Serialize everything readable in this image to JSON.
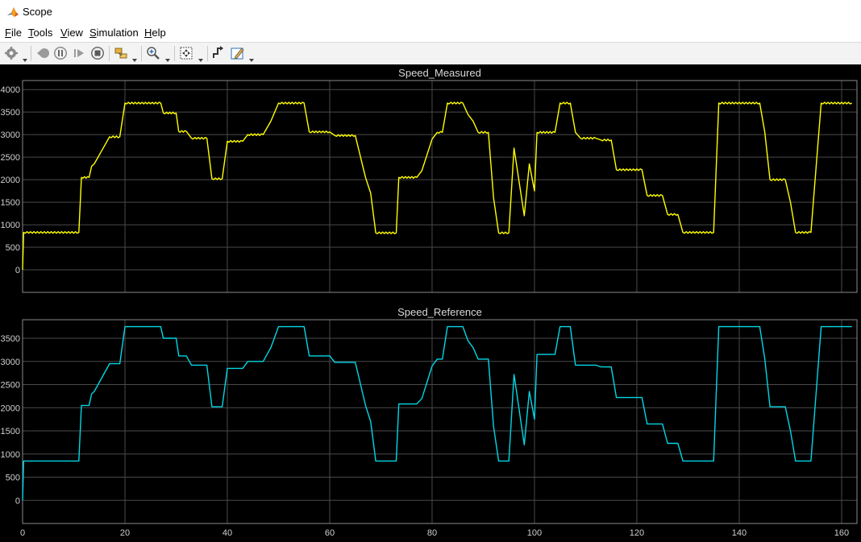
{
  "window": {
    "title": "Scope"
  },
  "menu": [
    {
      "label": "File",
      "key": "F",
      "rest": "ile"
    },
    {
      "label": "Tools",
      "key": "T",
      "rest": "ools"
    },
    {
      "label": "View",
      "key": "V",
      "rest": "iew"
    },
    {
      "label": "Simulation",
      "key": "S",
      "rest": "imulation"
    },
    {
      "label": "Help",
      "key": "H",
      "rest": "elp"
    }
  ],
  "toolbar": [
    "gear-icon",
    "step-back-icon",
    "pause-icon",
    "step-forward-icon",
    "stop-icon",
    "highlight-block-icon",
    "zoom-in-icon",
    "zoom-to-fit-icon",
    "trigger-icon",
    "write-data-icon"
  ],
  "colors": {
    "measured": "#ffff00",
    "reference": "#00d8e6",
    "background": "#000000",
    "grid": "#4a4a4a",
    "axes": "#8a8a8a"
  },
  "chart_data": [
    {
      "type": "line",
      "title": "Speed_Measured",
      "xlim": [
        0,
        163
      ],
      "ylim": [
        -500,
        4200
      ],
      "xticks": [
        0,
        20,
        40,
        60,
        80,
        100,
        120,
        140,
        160
      ],
      "yticks": [
        0,
        500,
        1000,
        1500,
        2000,
        2500,
        3000,
        3500,
        4000
      ],
      "grid": true,
      "series": [
        {
          "color": "#ffff00",
          "noise": true,
          "points": [
            [
              0,
              0
            ],
            [
              0.2,
              830
            ],
            [
              11,
              830
            ],
            [
              11.5,
              2050
            ],
            [
              13,
              2050
            ],
            [
              13.5,
              2300
            ],
            [
              14,
              2350
            ],
            [
              17,
              2950
            ],
            [
              19,
              2950
            ],
            [
              20,
              3700
            ],
            [
              27,
              3700
            ],
            [
              27.5,
              3480
            ],
            [
              30,
              3480
            ],
            [
              30.5,
              3070
            ],
            [
              32,
              3070
            ],
            [
              33,
              2920
            ],
            [
              36,
              2920
            ],
            [
              37,
              2020
            ],
            [
              39,
              2020
            ],
            [
              40,
              2850
            ],
            [
              43,
              2850
            ],
            [
              44,
              3000
            ],
            [
              47,
              3000
            ],
            [
              48,
              3200
            ],
            [
              48.5,
              3300
            ],
            [
              50,
              3700
            ],
            [
              55,
              3700
            ],
            [
              56,
              3060
            ],
            [
              60,
              3060
            ],
            [
              61,
              2980
            ],
            [
              65,
              2980
            ],
            [
              67,
              2050
            ],
            [
              68,
              1700
            ],
            [
              69,
              820
            ],
            [
              73,
              820
            ],
            [
              73.5,
              2050
            ],
            [
              77,
              2050
            ],
            [
              78,
              2200
            ],
            [
              80,
              2900
            ],
            [
              81,
              3050
            ],
            [
              82,
              3050
            ],
            [
              83,
              3700
            ],
            [
              86,
              3700
            ],
            [
              87,
              3450
            ],
            [
              88,
              3300
            ],
            [
              89,
              3050
            ],
            [
              91,
              3050
            ],
            [
              92,
              1600
            ],
            [
              93,
              820
            ],
            [
              95,
              820
            ],
            [
              96,
              2700
            ],
            [
              98,
              1200
            ],
            [
              99,
              2350
            ],
            [
              100,
              1750
            ],
            [
              100.5,
              3050
            ],
            [
              104,
              3050
            ],
            [
              105,
              3700
            ],
            [
              107,
              3700
            ],
            [
              108,
              3050
            ],
            [
              109,
              2920
            ],
            [
              112,
              2920
            ],
            [
              113,
              2880
            ],
            [
              115,
              2880
            ],
            [
              116,
              2220
            ],
            [
              121,
              2220
            ],
            [
              122,
              1650
            ],
            [
              125,
              1650
            ],
            [
              126,
              1230
            ],
            [
              128,
              1230
            ],
            [
              129,
              830
            ],
            [
              135,
              830
            ],
            [
              136,
              3700
            ],
            [
              144,
              3700
            ],
            [
              145,
              3050
            ],
            [
              146,
              2000
            ],
            [
              149,
              2000
            ],
            [
              150,
              1500
            ],
            [
              151,
              830
            ],
            [
              154,
              830
            ],
            [
              156,
              3700
            ],
            [
              162,
              3700
            ]
          ]
        }
      ]
    },
    {
      "type": "line",
      "title": "Speed_Reference",
      "xlim": [
        0,
        163
      ],
      "ylim": [
        -500,
        3900
      ],
      "xticks": [
        0,
        20,
        40,
        60,
        80,
        100,
        120,
        140,
        160
      ],
      "yticks": [
        0,
        500,
        1000,
        1500,
        2000,
        2500,
        3000,
        3500
      ],
      "grid": true,
      "series": [
        {
          "color": "#00d8e6",
          "noise": false,
          "points": [
            [
              0,
              0
            ],
            [
              0.2,
              850
            ],
            [
              11,
              850
            ],
            [
              11.5,
              2050
            ],
            [
              13,
              2050
            ],
            [
              13.5,
              2300
            ],
            [
              14,
              2350
            ],
            [
              17,
              2950
            ],
            [
              19,
              2950
            ],
            [
              20,
              3750
            ],
            [
              27,
              3750
            ],
            [
              27.5,
              3500
            ],
            [
              30,
              3500
            ],
            [
              30.5,
              3120
            ],
            [
              32,
              3120
            ],
            [
              33,
              2920
            ],
            [
              36,
              2920
            ],
            [
              37,
              2020
            ],
            [
              39,
              2020
            ],
            [
              40,
              2850
            ],
            [
              43,
              2850
            ],
            [
              44,
              3000
            ],
            [
              47,
              3000
            ],
            [
              48,
              3200
            ],
            [
              48.5,
              3300
            ],
            [
              50,
              3750
            ],
            [
              55,
              3750
            ],
            [
              56,
              3120
            ],
            [
              60,
              3120
            ],
            [
              61,
              2980
            ],
            [
              65,
              2980
            ],
            [
              67,
              2050
            ],
            [
              68,
              1700
            ],
            [
              69,
              850
            ],
            [
              73,
              850
            ],
            [
              73.5,
              2080
            ],
            [
              77,
              2080
            ],
            [
              78,
              2200
            ],
            [
              80,
              2900
            ],
            [
              81,
              3050
            ],
            [
              82,
              3050
            ],
            [
              83,
              3750
            ],
            [
              86,
              3750
            ],
            [
              87,
              3450
            ],
            [
              88,
              3300
            ],
            [
              89,
              3050
            ],
            [
              91,
              3050
            ],
            [
              92,
              1600
            ],
            [
              93,
              850
            ],
            [
              95,
              850
            ],
            [
              96,
              2720
            ],
            [
              98,
              1200
            ],
            [
              99,
              2350
            ],
            [
              100,
              1750
            ],
            [
              100.5,
              3150
            ],
            [
              104,
              3150
            ],
            [
              105,
              3750
            ],
            [
              107,
              3750
            ],
            [
              108,
              2920
            ],
            [
              112,
              2920
            ],
            [
              113,
              2880
            ],
            [
              115,
              2880
            ],
            [
              116,
              2220
            ],
            [
              121,
              2220
            ],
            [
              122,
              1650
            ],
            [
              125,
              1650
            ],
            [
              126,
              1230
            ],
            [
              128,
              1230
            ],
            [
              129,
              850
            ],
            [
              135,
              850
            ],
            [
              136,
              3750
            ],
            [
              144,
              3750
            ],
            [
              145,
              3050
            ],
            [
              146,
              2020
            ],
            [
              149,
              2020
            ],
            [
              150,
              1500
            ],
            [
              151,
              850
            ],
            [
              154,
              850
            ],
            [
              156,
              3750
            ],
            [
              162,
              3750
            ]
          ]
        }
      ]
    }
  ]
}
